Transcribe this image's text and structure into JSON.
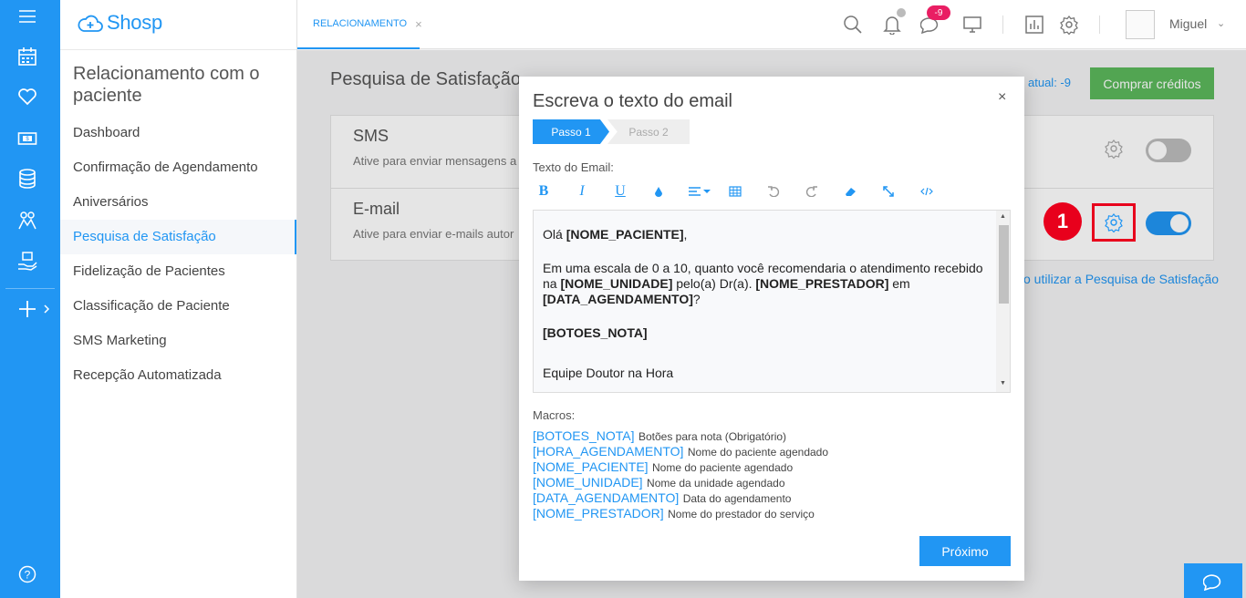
{
  "app": {
    "brand": "Shosp",
    "accent": "#2196f3"
  },
  "rail": {
    "icons": [
      "menu-icon",
      "calendar-icon",
      "heart-icon",
      "money-icon",
      "database-icon",
      "people-icon",
      "hand-heart-icon",
      "plus-icon",
      "chevron-right-icon",
      "help-icon"
    ]
  },
  "sidebar": {
    "title": "Relacionamento com o paciente",
    "items": [
      {
        "label": "Dashboard"
      },
      {
        "label": "Confirmação de Agendamento"
      },
      {
        "label": "Aniversários"
      },
      {
        "label": "Pesquisa de Satisfação",
        "active": true
      },
      {
        "label": "Fidelização de Pacientes"
      },
      {
        "label": "Classificação de Paciente"
      },
      {
        "label": "SMS Marketing"
      },
      {
        "label": "Recepção Automatizada"
      }
    ]
  },
  "topbar": {
    "tab_label": "RELACIONAMENTO",
    "tab_close": "×",
    "chat_badge": "-9",
    "user_name": "Miguel",
    "user_caret": "⌄"
  },
  "page": {
    "title": "Pesquisa de Satisfação",
    "saldo": "atual: -9",
    "buy_button": "Comprar créditos",
    "help_link": "o utilizar a Pesquisa de Satisfação",
    "rows": [
      {
        "title": "SMS",
        "desc": "Ative para enviar mensagens a",
        "enabled": false
      },
      {
        "title": "E-mail",
        "desc": "Ative para enviar e-mails autor",
        "enabled": true
      }
    ]
  },
  "callout": {
    "number": "1",
    "color": "#e8001c"
  },
  "modal": {
    "title": "Escreva o texto do email",
    "close": "×",
    "step1": "Passo 1",
    "step2": "Passo 2",
    "email_label": "Texto do Email:",
    "toolbar": {
      "bold": "B",
      "italic": "I",
      "underline": "U"
    },
    "editor": {
      "greeting_prefix": "Olá ",
      "greeting_macro": "[NOME_PACIENTE]",
      "greeting_suffix": ",",
      "line2_a": "Em uma escala de 0 a 10, quanto você recomendaria o atendimento recebido na ",
      "line2_b": "[NOME_UNIDADE]",
      "line2_c": " pelo(a) Dr(a). ",
      "line2_d": "[NOME_PRESTADOR]",
      "line2_e": " em ",
      "line2_f": "[DATA_AGENDAMENTO]",
      "line2_g": "?",
      "buttons": "[BOTOES_NOTA]",
      "signature": "Equipe Doutor na Hora"
    },
    "macros_label": "Macros:",
    "macros": [
      {
        "key": "[BOTOES_NOTA]",
        "desc": "Botões para nota (Obrigatório)"
      },
      {
        "key": "[HORA_AGENDAMENTO]",
        "desc": "Nome do paciente agendado"
      },
      {
        "key": "[NOME_PACIENTE]",
        "desc": "Nome do paciente agendado"
      },
      {
        "key": "[NOME_UNIDADE]",
        "desc": "Nome da unidade agendado"
      },
      {
        "key": "[DATA_AGENDAMENTO]",
        "desc": "Data do agendamento"
      },
      {
        "key": "[NOME_PRESTADOR]",
        "desc": "Nome do prestador do serviço"
      }
    ],
    "next_button": "Próximo"
  }
}
